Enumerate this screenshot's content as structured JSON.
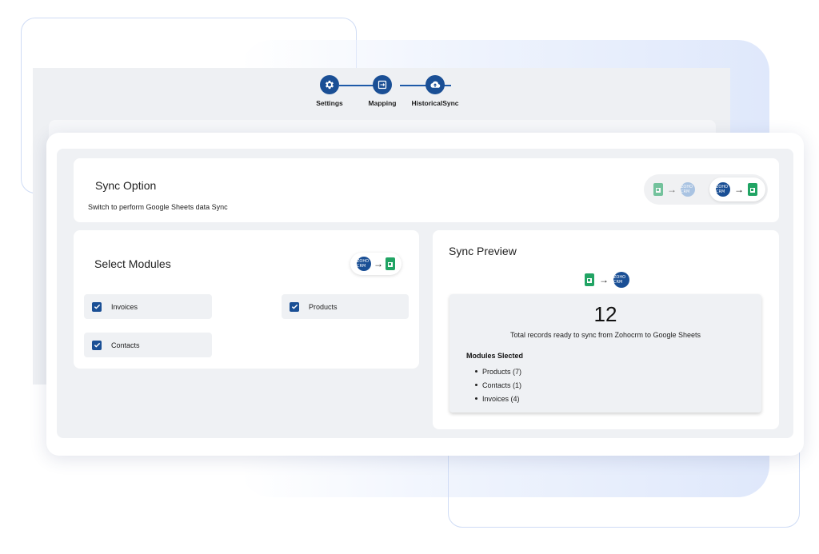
{
  "stepper": {
    "steps": [
      {
        "label": "Settings",
        "icon": "gear-icon"
      },
      {
        "label": "Mapping",
        "icon": "mapping-icon"
      },
      {
        "label": "HistoricalSync",
        "icon": "cloud-upload-icon"
      }
    ]
  },
  "sync_option": {
    "title": "Sync Option",
    "description": "Switch to perform Google Sheets data Sync",
    "toggle": {
      "options": [
        "sheets-to-crm",
        "crm-to-sheets"
      ],
      "selected": "crm-to-sheets"
    }
  },
  "modules": {
    "title": "Select Modules",
    "direction": "crm-to-sheets",
    "items": [
      {
        "label": "Invoices",
        "checked": true
      },
      {
        "label": "Products",
        "checked": true
      },
      {
        "label": "Contacts",
        "checked": true
      }
    ]
  },
  "preview": {
    "title": "Sync Preview",
    "total": "12",
    "total_description": "Total records ready to sync from Zohocrm to Google Sheets",
    "modules_heading": "Modules Slected",
    "selected": [
      "Products (7)",
      "Contacts (1)",
      "Invoices (4)"
    ]
  },
  "icons": {
    "crm_text": "ZOHO CRM",
    "arrow": "→"
  },
  "colors": {
    "accent": "#1a4f95",
    "sheets_green": "#21a464",
    "panel_bg": "#eff1f4"
  }
}
